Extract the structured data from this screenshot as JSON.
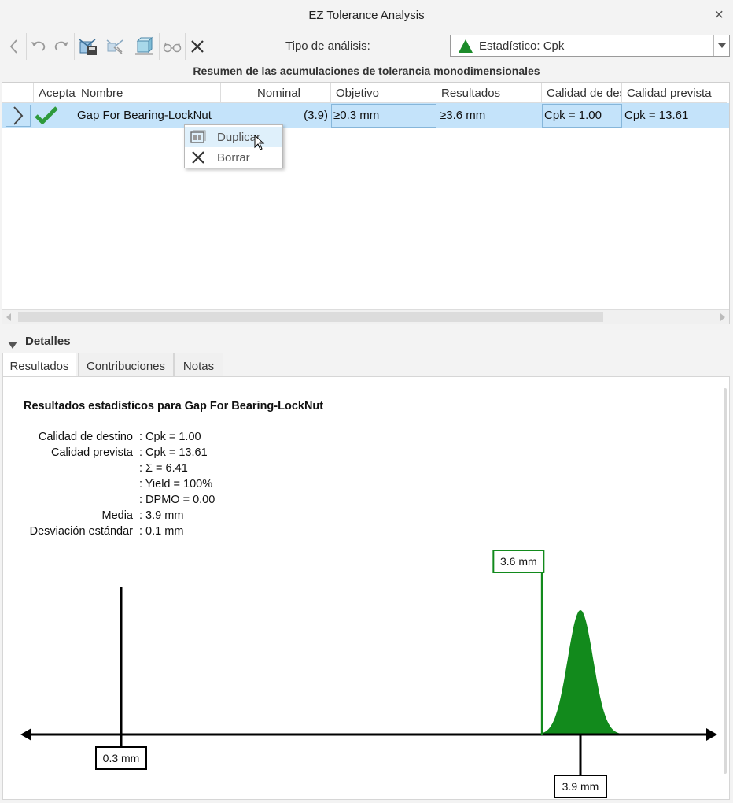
{
  "window": {
    "title": "EZ Tolerance Analysis",
    "close_glyph": "×"
  },
  "toolbar": {
    "analysis_type_label": "Tipo de análisis:",
    "analysis_type_value": "Estadístico: Cpk",
    "icons": [
      "back-icon",
      "undo-icon",
      "redo-icon",
      "save-stack-icon",
      "auto-stack-icon",
      "model-view-icon",
      "glasses-icon",
      "delete-icon"
    ]
  },
  "summary": {
    "title": "Resumen de las acumulaciones de tolerancia monodimensionales",
    "columns": [
      "Acepta",
      "Nombre",
      "Nominal",
      "Objetivo",
      "Resultados",
      "Calidad de destino",
      "Calidad prevista"
    ],
    "rows": [
      {
        "name": "Gap For Bearing-LockNut",
        "nominal": "(3.9)",
        "objetivo": "≥0.3 mm",
        "resultados": "≥3.6 mm",
        "calidad_destino": "Cpk = 1.00",
        "calidad_prevista": "Cpk = 13.61"
      }
    ]
  },
  "context_menu": {
    "items": [
      {
        "label": "Duplicar",
        "icon": "duplicate-icon",
        "hover": true
      },
      {
        "label": "Borrar",
        "icon": "delete-icon",
        "hover": false
      }
    ]
  },
  "details": {
    "section_label": "Detalles",
    "tabs": [
      "Resultados",
      "Contribuciones",
      "Notas"
    ],
    "active_tab": "Resultados",
    "results_title": "Resultados estadísticos para Gap For Bearing-LockNut",
    "lines": [
      {
        "label": "Calidad de destino",
        "value": ": Cpk = 1.00"
      },
      {
        "label": "Calidad prevista",
        "value": ": Cpk = 13.61"
      },
      {
        "label": "",
        "value": ": Σ = 6.41"
      },
      {
        "label": "",
        "value": ": Yield = 100%"
      },
      {
        "label": "",
        "value": ": DPMO = 0.00"
      },
      {
        "label": "Media",
        "value": ": 3.9 mm"
      },
      {
        "label": "Desviación estándar",
        "value": ": 0.1 mm"
      }
    ]
  },
  "chart_data": {
    "type": "area",
    "title": "",
    "xlabel": "",
    "ylabel": "",
    "distribution": {
      "mean": 3.9,
      "std_dev": 0.1
    },
    "markers": [
      {
        "label": "0.3 mm",
        "value": 0.3,
        "role": "objetivo"
      },
      {
        "label": "3.6 mm",
        "value": 3.6,
        "role": "resultado"
      },
      {
        "label": "3.9 mm",
        "value": 3.9,
        "role": "media"
      }
    ],
    "xlim": [
      0.0,
      4.42
    ],
    "colors": {
      "curve": "#128a1c",
      "marker_result": "#128a1c",
      "axis": "#000000"
    }
  }
}
